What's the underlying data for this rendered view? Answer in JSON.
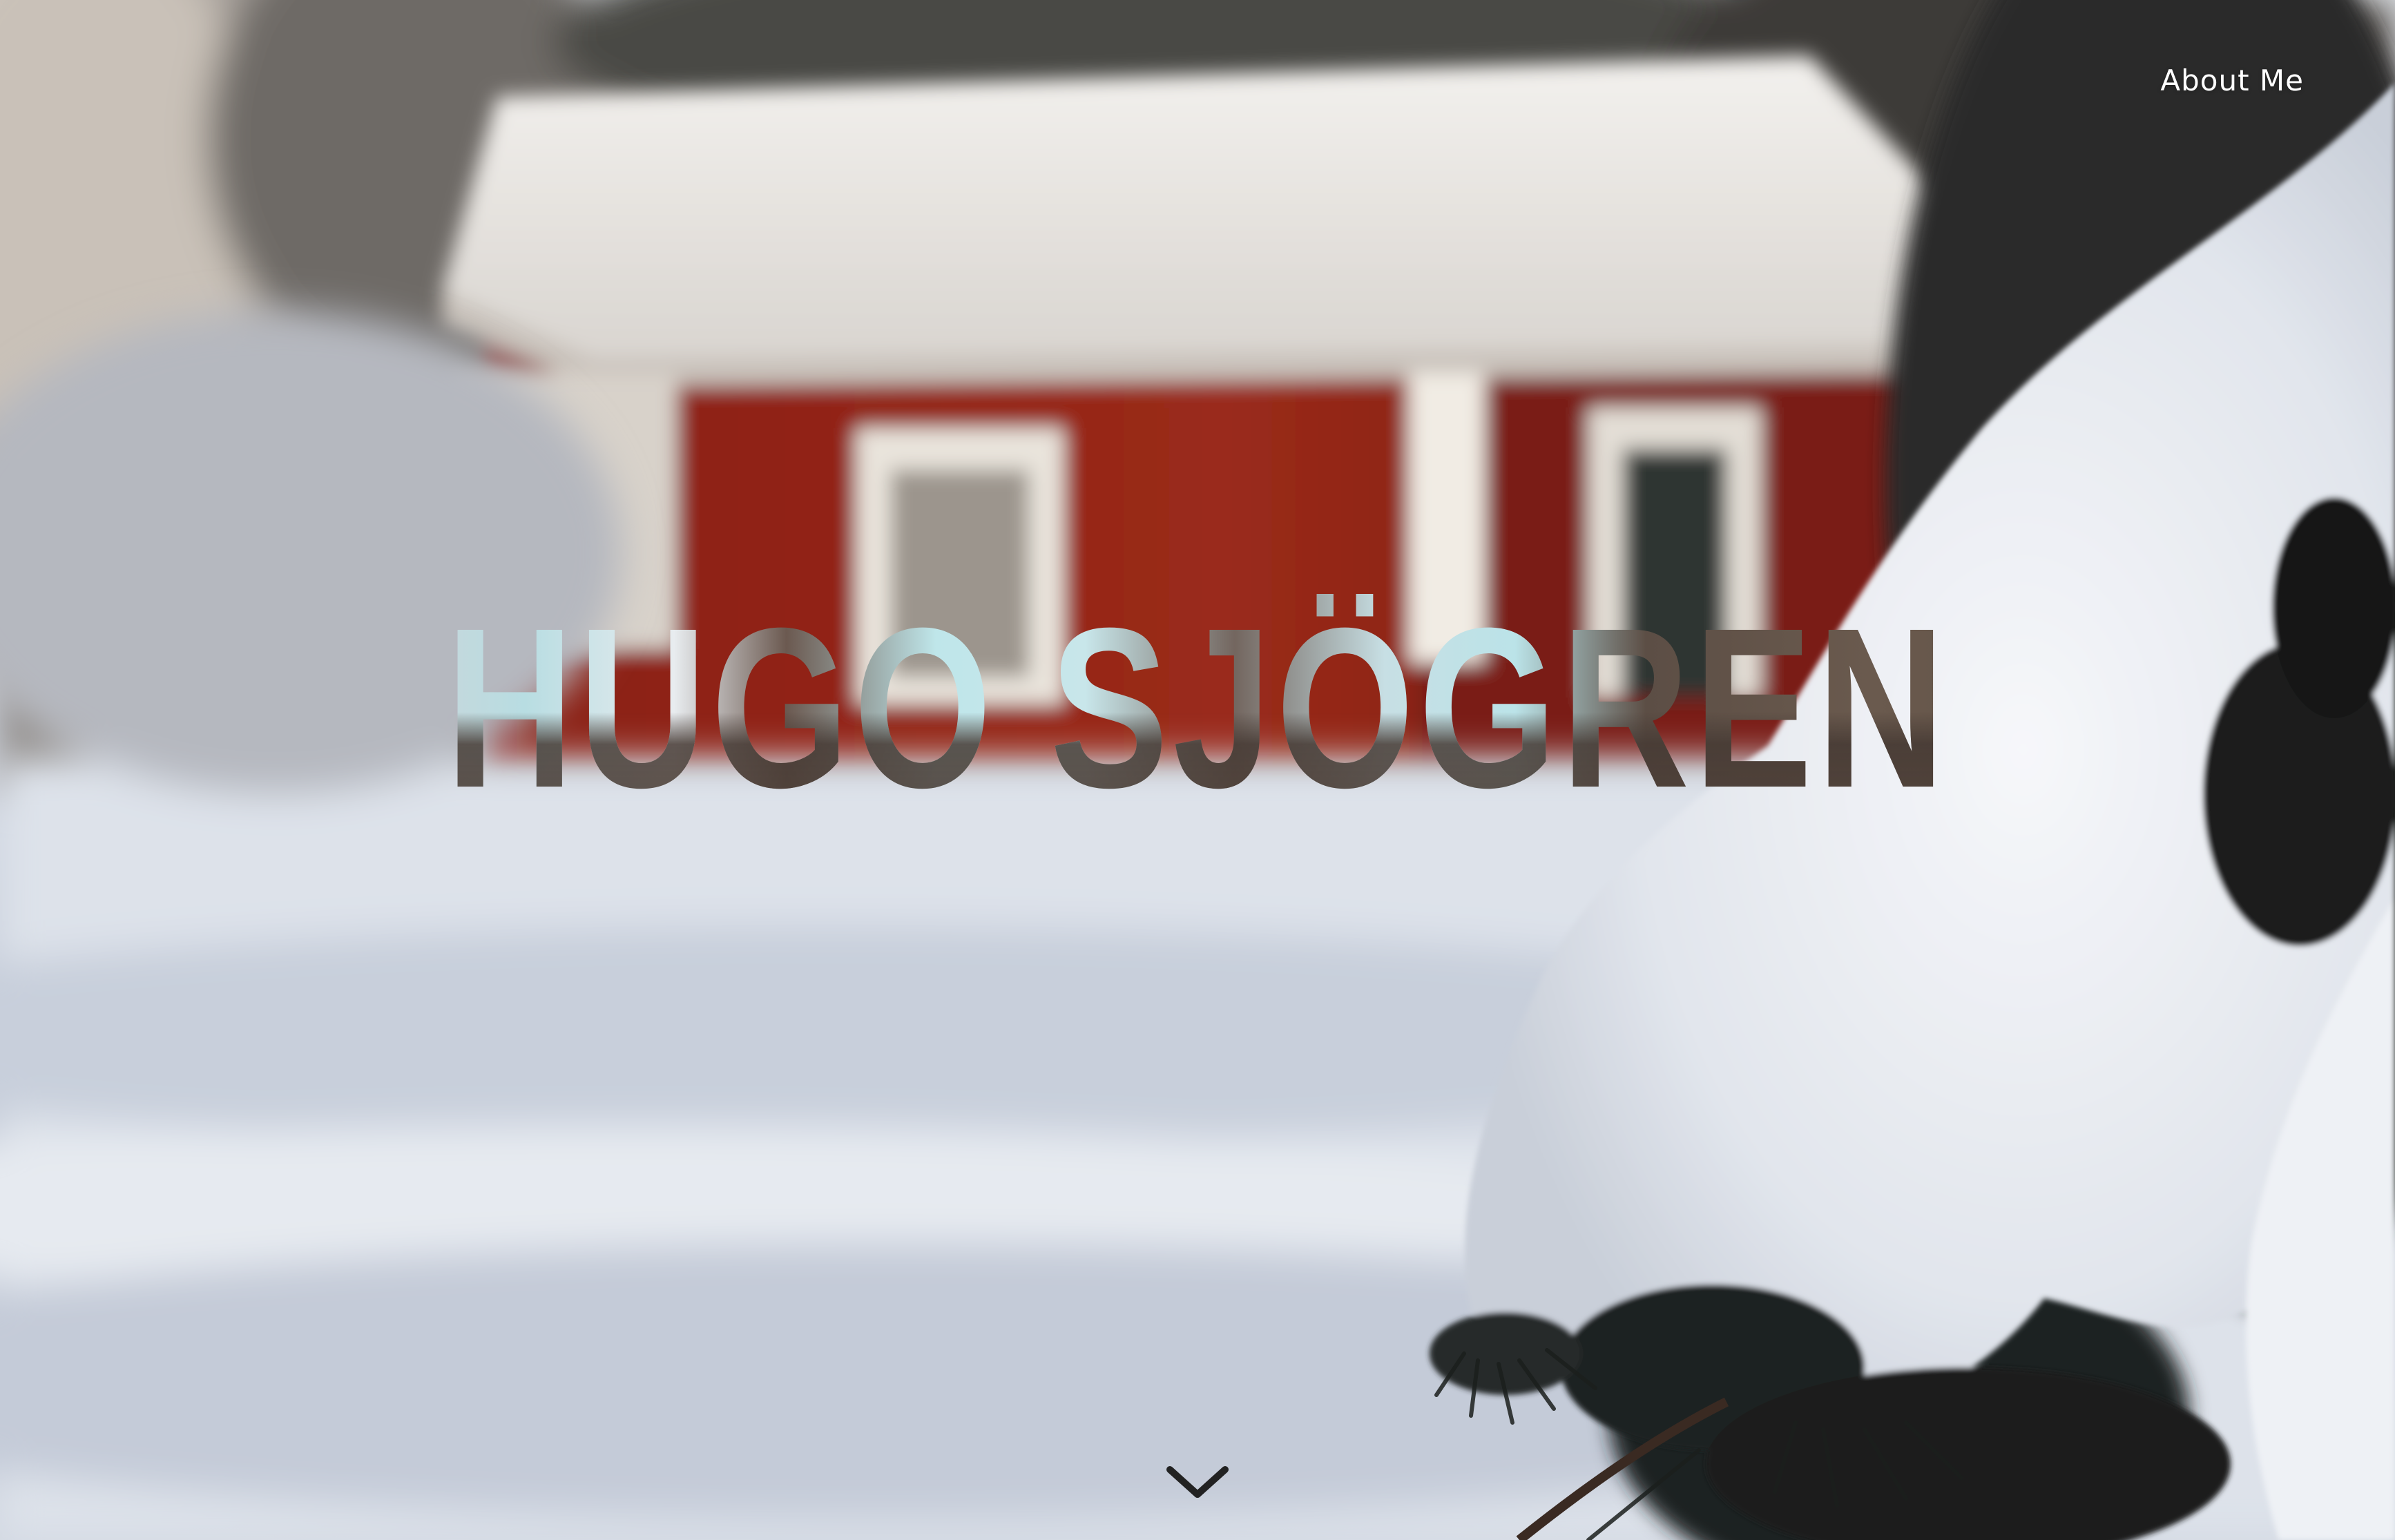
{
  "nav": {
    "about_label": "About Me"
  },
  "hero": {
    "title": "HUGO SJÖGREN",
    "background_icon": "winter-cabin-photo",
    "scroll_icon": "chevron-down-icon"
  },
  "colors": {
    "nav_text": "#ffffff",
    "title_light": "#c8e6ea",
    "title_dark": "#5e4f43",
    "chevron": "#222222"
  }
}
